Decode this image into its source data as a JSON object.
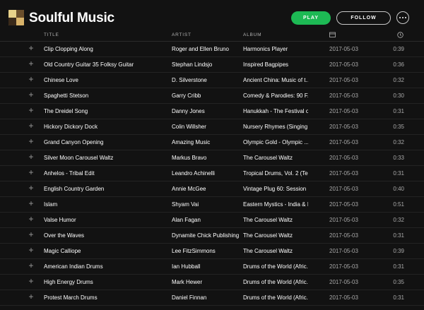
{
  "playlist": {
    "title": "Soulful Music",
    "play_label": "PLAY",
    "follow_label": "FOLLOW"
  },
  "columns": {
    "title": "TITLE",
    "artist": "ARTIST",
    "album": "ALBUM"
  },
  "tracks": [
    {
      "title": "Clip Clopping Along",
      "artist": "Roger and Ellen Bruno",
      "album": "Harmonics Player",
      "date": "2017-05-03",
      "duration": "0:39"
    },
    {
      "title": "Old Country Guitar 35 Folksy Guitar",
      "artist": "Stephan Lindsjo",
      "album": "Inspired Bagpipes",
      "date": "2017-05-03",
      "duration": "0:36"
    },
    {
      "title": "Chinese Love",
      "artist": "D. Silverstone",
      "album": "Ancient China: Music of t...",
      "date": "2017-05-03",
      "duration": "0:32"
    },
    {
      "title": "Spaghetti Stetson",
      "artist": "Garry Cribb",
      "album": "Comedy & Parodies: 90 F...",
      "date": "2017-05-03",
      "duration": "0:30"
    },
    {
      "title": "The Dreidel Song",
      "artist": "Danny Jones",
      "album": "Hanukkah - The Festival o...",
      "date": "2017-05-03",
      "duration": "0:31"
    },
    {
      "title": "Hickory Dickory Dock",
      "artist": "Colin Willsher",
      "album": "Nursery Rhymes (Singing ...",
      "date": "2017-05-03",
      "duration": "0:35"
    },
    {
      "title": "Grand Canyon Opening",
      "artist": "Amazing Music",
      "album": "Olympic Gold - Olympic ...",
      "date": "2017-05-03",
      "duration": "0:32"
    },
    {
      "title": "Silver Moon Carousel Waltz",
      "artist": "Markus Bravo",
      "album": "The Carousel Waltz",
      "date": "2017-05-03",
      "duration": "0:33"
    },
    {
      "title": "Anhelos - Tribal Edit",
      "artist": "Leandro Achinelli",
      "album": "Tropical Drums, Vol. 2 (Te...",
      "date": "2017-05-03",
      "duration": "0:31"
    },
    {
      "title": "English Country Garden",
      "artist": "Annie McGee",
      "album": "Vintage Plug 60: Session 1...",
      "date": "2017-05-03",
      "duration": "0:40"
    },
    {
      "title": "Islam",
      "artist": "Shyam Vai",
      "album": "Eastern Mystics - India & I...",
      "date": "2017-05-03",
      "duration": "0:51"
    },
    {
      "title": "Valse Humor",
      "artist": "Alan Fagan",
      "album": "The Carousel Waltz",
      "date": "2017-05-03",
      "duration": "0:32"
    },
    {
      "title": "Over the Waves",
      "artist": "Dynamite Chick Publishing",
      "album": "The Carousel Waltz",
      "date": "2017-05-03",
      "duration": "0:31"
    },
    {
      "title": "Magic Calliope",
      "artist": "Lee FitzSimmons",
      "album": "The Carousel Waltz",
      "date": "2017-05-03",
      "duration": "0:39"
    },
    {
      "title": "American Indian Drums",
      "artist": "Ian Hubball",
      "album": "Drums of the World (Afric...",
      "date": "2017-05-03",
      "duration": "0:31"
    },
    {
      "title": "High Energy Drums",
      "artist": "Mark Hewer",
      "album": "Drums of the World (Afric...",
      "date": "2017-05-03",
      "duration": "0:35"
    },
    {
      "title": "Protest March Drums",
      "artist": "Daniel Finnan",
      "album": "Drums of the World (Afric...",
      "date": "2017-05-03",
      "duration": "0:31"
    }
  ],
  "icons": {
    "add": "plus-icon",
    "date_header": "calendar-icon",
    "duration_header": "clock-icon",
    "more": "more-dots-icon"
  },
  "colors": {
    "background": "#121212",
    "accent": "#1db954"
  }
}
